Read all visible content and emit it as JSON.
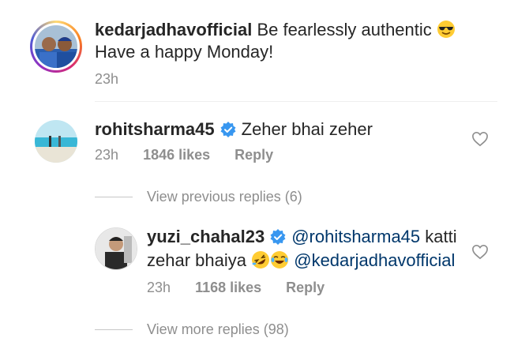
{
  "post": {
    "username": "kedarjadhavofficial",
    "caption_line1": "Be fearlessly authentic",
    "caption_line2": "Have a happy Monday!",
    "time": "23h",
    "emoji": "sunglasses-emoji"
  },
  "comment": {
    "username": "rohitsharma45",
    "text": "Zeher bhai zeher",
    "time": "23h",
    "likes": "1846 likes",
    "reply_label": "Reply",
    "view_previous": "View previous replies (6)"
  },
  "reply": {
    "username": "yuzi_chahal23",
    "mention1": "@rohitsharma45",
    "text1": "katti",
    "text2": "zehar bhaiya",
    "mention2": "@kedarjadhavofficial",
    "time": "23h",
    "likes": "1168 likes",
    "reply_label": "Reply",
    "emojis": [
      "rolling-laughing-emoji",
      "tears-of-joy-emoji"
    ],
    "view_more": "View more replies (98)"
  },
  "colors": {
    "text": "#262626",
    "meta": "#8e8e8e",
    "mention": "#00376b",
    "verified": "#3897f0"
  }
}
